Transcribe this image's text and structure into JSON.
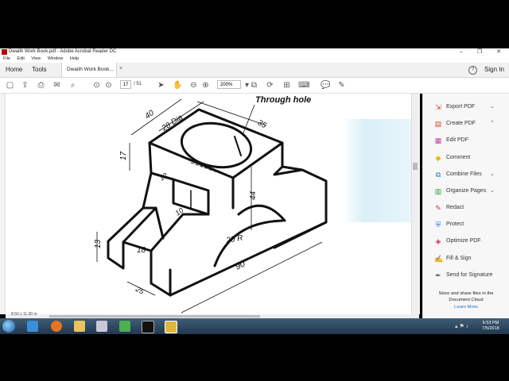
{
  "window": {
    "title": "Dwaith Work Book.pdf - Adobe Acrobat Reader DC",
    "controls": "– ❐ ✕"
  },
  "menu": [
    "File",
    "Edit",
    "View",
    "Window",
    "Help"
  ],
  "tabs": {
    "home": "Home",
    "tools": "Tools",
    "document": "Dwaith Work Book...",
    "close": "×"
  },
  "help": "?",
  "signin": "Sign In",
  "toolbar": {
    "page_current": "17",
    "page_total": "/ 51",
    "zoom": "200%"
  },
  "drawing": {
    "label_hole": "Through hole",
    "dim_40": "40",
    "dim_28": "28 Dia",
    "dim_35": "35",
    "dim_17": "17",
    "dim_12": "12",
    "dim_10": "10",
    "dim_44": "44",
    "dim_13": "13",
    "dim_18": "18",
    "dim_20r": "20 R",
    "dim_90": "90",
    "dim_25": "25"
  },
  "status": {
    "page_size": "8.50 x 11.00 in"
  },
  "right_pane": {
    "items": [
      {
        "label": "Export PDF",
        "icon": "export-pdf-icon",
        "color": "#d14a2b",
        "chevron": "⌄"
      },
      {
        "label": "Create PDF",
        "icon": "create-pdf-icon",
        "color": "#d14a2b",
        "chevron": "⌃"
      },
      {
        "label": "Edit PDF",
        "icon": "edit-pdf-icon",
        "color": "#c0429a",
        "chevron": ""
      },
      {
        "label": "Comment",
        "icon": "comment-icon",
        "color": "#f0b400",
        "chevron": ""
      },
      {
        "label": "Combine Files",
        "icon": "combine-files-icon",
        "color": "#2a6fd1",
        "chevron": "⌄"
      },
      {
        "label": "Organize Pages",
        "icon": "organize-pages-icon",
        "color": "#2e9e3e",
        "chevron": "⌄"
      },
      {
        "label": "Redact",
        "icon": "redact-icon",
        "color": "#d1345b",
        "chevron": ""
      },
      {
        "label": "Protect",
        "icon": "protect-icon",
        "color": "#2a6fd1",
        "chevron": ""
      },
      {
        "label": "Optimize PDF",
        "icon": "optimize-pdf-icon",
        "color": "#d1345b",
        "chevron": ""
      },
      {
        "label": "Fill & Sign",
        "icon": "fill-sign-icon",
        "color": "#7b4fd1",
        "chevron": ""
      },
      {
        "label": "Send for Signature",
        "icon": "send-signature-icon",
        "color": "#555",
        "chevron": ""
      }
    ],
    "footer": "Store and share files in the Document Cloud",
    "learn_more": "Learn More"
  },
  "taskbar": {
    "time": "6:53 PM",
    "date": "7/5/2018"
  }
}
